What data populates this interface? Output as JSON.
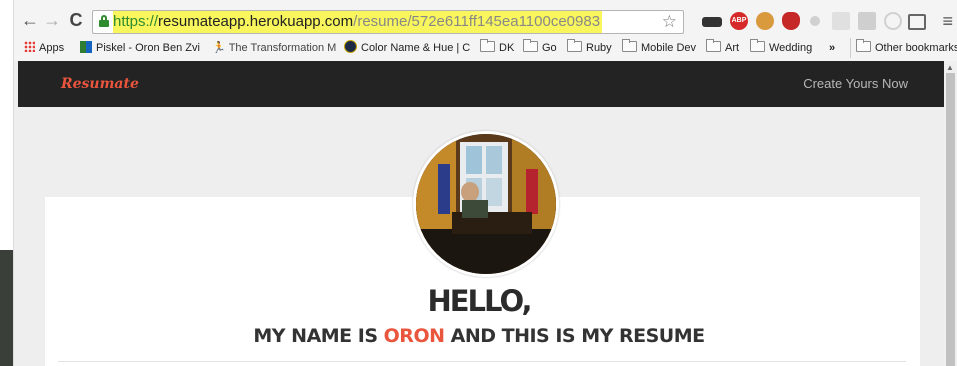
{
  "browser": {
    "url": {
      "scheme": "https://",
      "host": "resumateapp.herokuapp.com",
      "path": "/resume/572e611ff145ea1100ce0983"
    },
    "extensions": [
      "incognito-glasses-icon",
      "adblock-icon",
      "cookie-icon",
      "lastpass-icon",
      "dot-icon",
      "puzzle-icon",
      "dropbox-icon",
      "refresh-icon",
      "cast-icon"
    ],
    "bookmarks": [
      {
        "label": "Apps",
        "icon": "apps-grid-icon"
      },
      {
        "label": "Piskel - Oron Ben Zvi",
        "icon": "piskel-icon"
      },
      {
        "label": "The Transformation M",
        "icon": "figure-icon"
      },
      {
        "label": "Color Name & Hue | C",
        "icon": "color-ball-icon"
      },
      {
        "label": "DK",
        "icon": "folder-icon"
      },
      {
        "label": "Go",
        "icon": "folder-icon"
      },
      {
        "label": "Ruby",
        "icon": "folder-icon"
      },
      {
        "label": "Mobile Dev",
        "icon": "folder-icon"
      },
      {
        "label": "Art",
        "icon": "folder-icon"
      },
      {
        "label": "Wedding",
        "icon": "folder-icon"
      }
    ],
    "overflow_label": "»",
    "other_bookmarks": "Other bookmarks"
  },
  "site": {
    "brand": "Resumate",
    "cta": "Create Yours Now",
    "hello": "HELLO,",
    "tagline_prefix": "MY NAME IS ",
    "tagline_name": "ORON",
    "tagline_suffix": " AND THIS IS MY RESUME"
  },
  "colors": {
    "accent": "#e9553d",
    "navbar": "#232323",
    "url_highlight": "#f8f65c"
  }
}
